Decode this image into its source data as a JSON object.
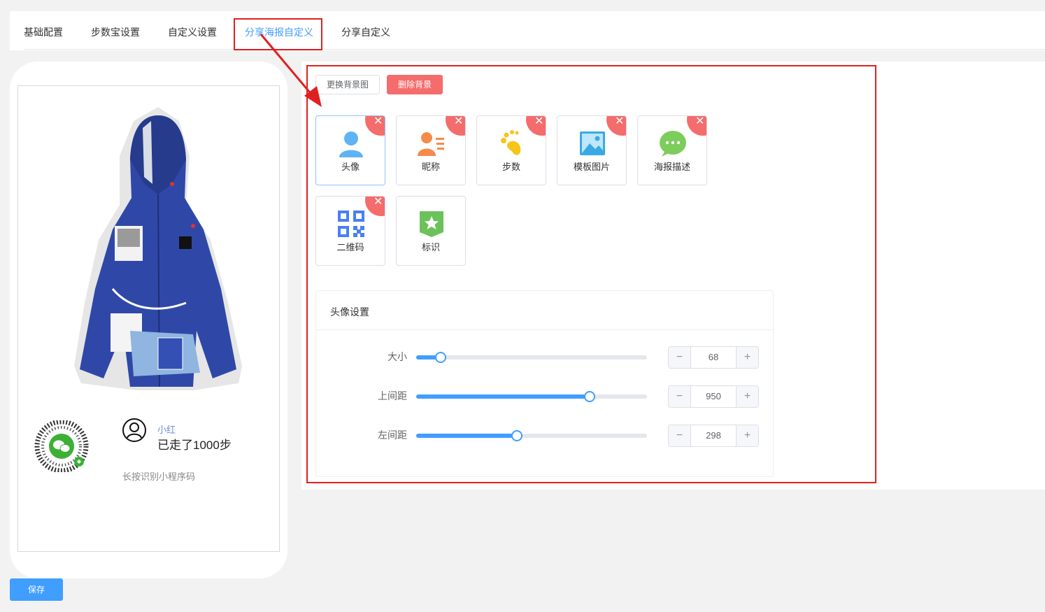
{
  "tabs": [
    {
      "label": "基础配置",
      "active": false
    },
    {
      "label": "步数宝设置",
      "active": false
    },
    {
      "label": "自定义设置",
      "active": false
    },
    {
      "label": "分享海报自定义",
      "active": true
    },
    {
      "label": "分享自定义",
      "active": false
    }
  ],
  "preview": {
    "nickname": "小红",
    "steps_text": "已走了1000步",
    "hint": "长按识别小程序码"
  },
  "actions": {
    "change_bg": "更换背景图",
    "delete_bg": "删除背景",
    "save": "保存"
  },
  "elements": [
    {
      "label": "头像",
      "icon": "avatar-icon",
      "removable": true,
      "active": true
    },
    {
      "label": "昵称",
      "icon": "nickname-icon",
      "removable": true,
      "active": false
    },
    {
      "label": "步数",
      "icon": "footprint-icon",
      "removable": true,
      "active": false
    },
    {
      "label": "模板图片",
      "icon": "image-icon",
      "removable": true,
      "active": false
    },
    {
      "label": "海报描述",
      "icon": "chat-bubble-icon",
      "removable": true,
      "active": false
    },
    {
      "label": "二维码",
      "icon": "qrcode-icon",
      "removable": true,
      "active": false
    },
    {
      "label": "标识",
      "icon": "star-badge-icon",
      "removable": false,
      "active": false
    }
  ],
  "settings": {
    "title": "头像设置",
    "rows": [
      {
        "label": "大小",
        "value": "68",
        "slider_fraction": 0.107
      },
      {
        "label": "上间距",
        "value": "950",
        "slider_fraction": 0.752
      },
      {
        "label": "左间距",
        "value": "298",
        "slider_fraction": 0.436
      }
    ]
  },
  "colors": {
    "accent": "#409eff",
    "danger": "#f56c6c",
    "highlight": "#e02020"
  }
}
